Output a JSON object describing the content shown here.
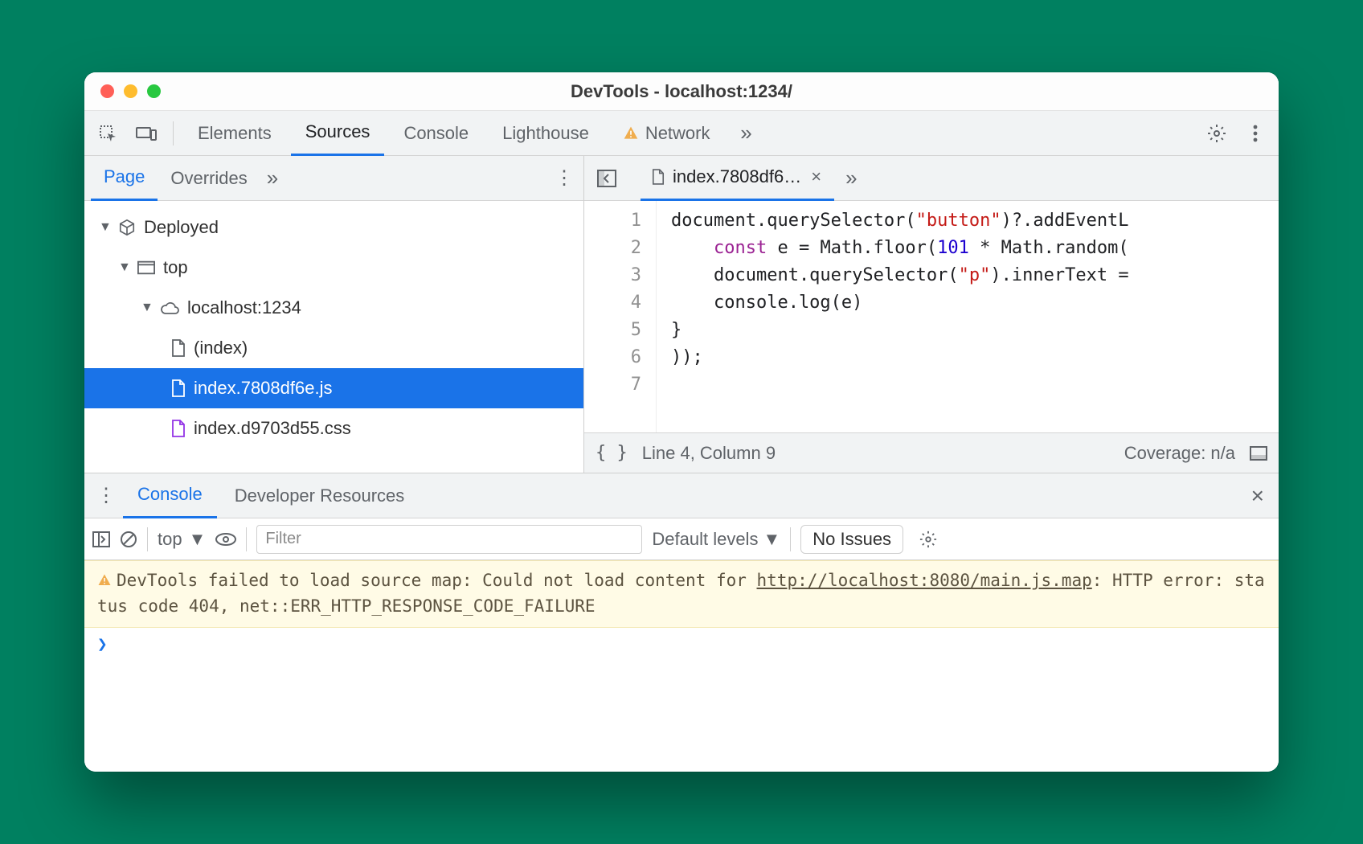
{
  "window": {
    "title": "DevTools - localhost:1234/"
  },
  "mainTabs": {
    "items": [
      "Elements",
      "Sources",
      "Console",
      "Lighthouse",
      "Network"
    ],
    "activeIndex": 1,
    "networkHasWarning": true
  },
  "navigator": {
    "tabs": {
      "items": [
        "Page",
        "Overrides"
      ],
      "activeIndex": 0
    },
    "tree": {
      "root": "Deployed",
      "top": "top",
      "origin": "localhost:1234",
      "files": [
        {
          "name": "(index)",
          "kind": "doc"
        },
        {
          "name": "index.7808df6e.js",
          "kind": "js",
          "selected": true
        },
        {
          "name": "index.d9703d55.css",
          "kind": "css"
        }
      ]
    }
  },
  "editor": {
    "openTab": "index.7808df6…",
    "lines": [
      "document.querySelector(\"button\")?.addEventL",
      "    const e = Math.floor(101 * Math.random(",
      "    document.querySelector(\"p\").innerText =",
      "    console.log(e)",
      "}",
      "));",
      ""
    ],
    "status": {
      "cursor": "Line 4, Column 9",
      "coverage": "Coverage: n/a"
    }
  },
  "drawer": {
    "tabs": {
      "items": [
        "Console",
        "Developer Resources"
      ],
      "activeIndex": 0
    },
    "toolbar": {
      "context": "top",
      "filterPlaceholder": "Filter",
      "levels": "Default levels",
      "issues": "No Issues"
    },
    "warning": {
      "prefix": "DevTools failed to load source map: Could not load content for ",
      "link": "http://localhost:8080/main.js.map",
      "suffix": ": HTTP error: status code 404, net::ERR_HTTP_RESPONSE_CODE_FAILURE"
    }
  }
}
